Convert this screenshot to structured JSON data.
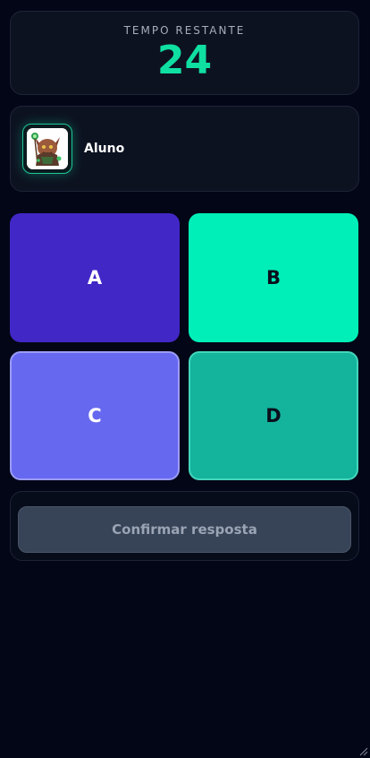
{
  "timer": {
    "label": "TEMPO RESTANTE",
    "value": "24"
  },
  "player": {
    "name": "Aluno",
    "avatar_icon": "monster-avatar-icon"
  },
  "options": [
    {
      "label": "A",
      "color": "#4227c7"
    },
    {
      "label": "B",
      "color": "#00efb8"
    },
    {
      "label": "C",
      "color": "#6768f0"
    },
    {
      "label": "D",
      "color": "#14b39c"
    }
  ],
  "confirm": {
    "label": "Confirmar resposta",
    "enabled": false
  },
  "colors": {
    "background": "#030617",
    "accent": "#10dfa2"
  }
}
